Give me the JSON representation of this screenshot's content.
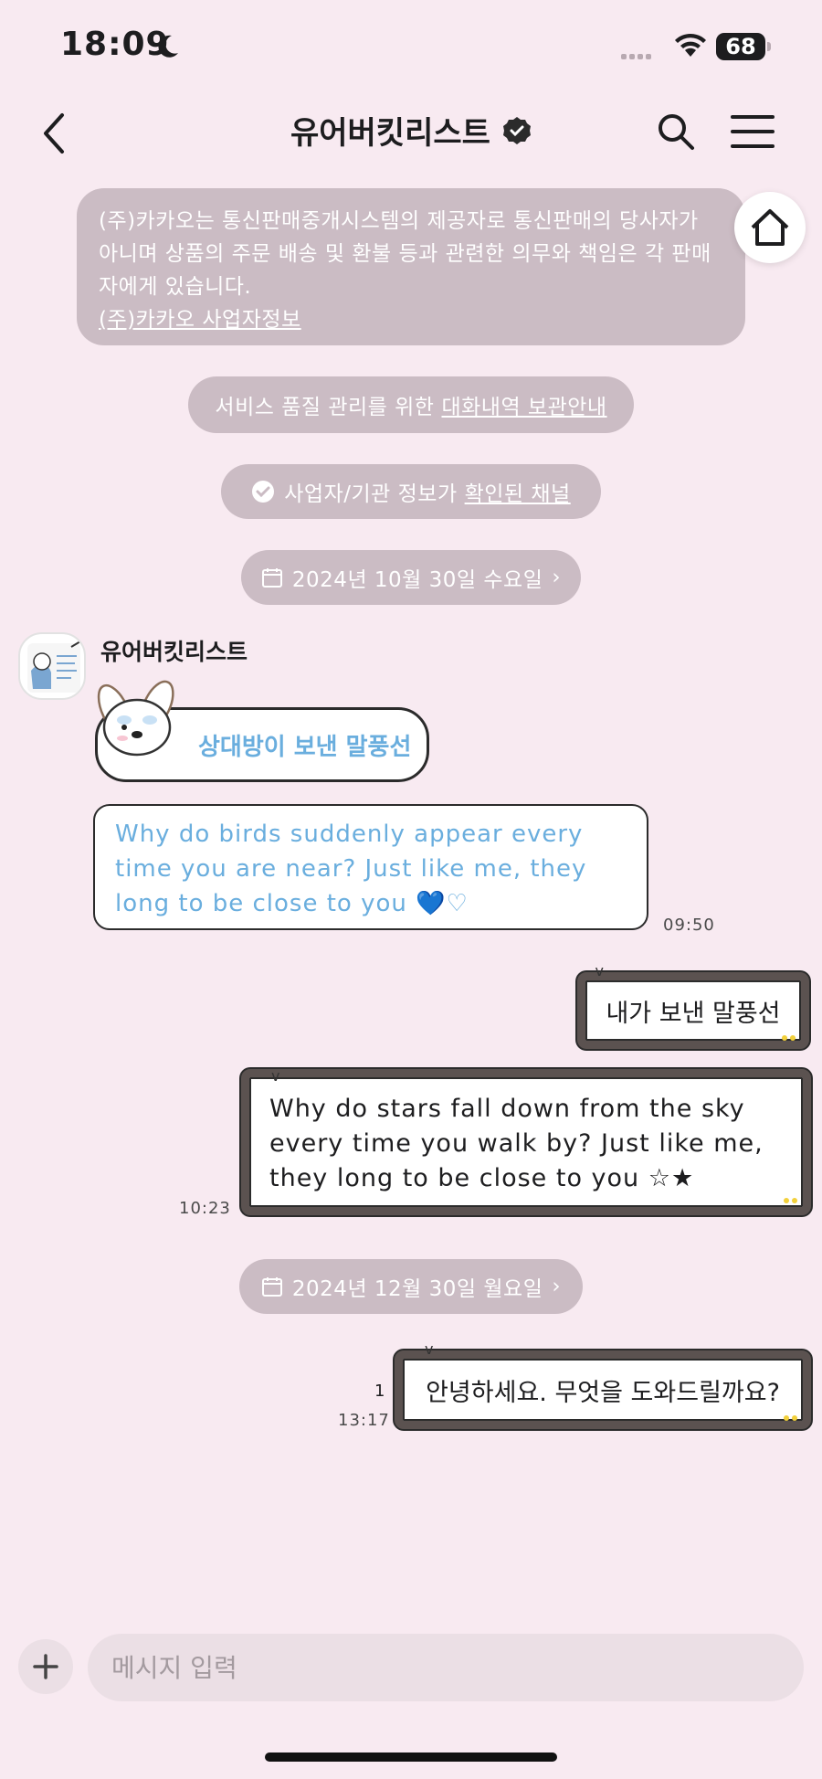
{
  "status_bar": {
    "time": "18:09",
    "battery": "68"
  },
  "header": {
    "title": "유어버킷리스트"
  },
  "notice": {
    "text": "(주)카카오는 통신판매중개시스템의 제공자로 통신판매의 당사자가 아니며 상품의 주문 배송 및 환불 등과 관련한 의무와 책임은 각 판매자에게 있습니다.",
    "link": "(주)카카오 사업자정보"
  },
  "service_notice": {
    "text": "서비스 품질 관리를 위한",
    "link": "대화내역 보관안내"
  },
  "verified_notice": {
    "text": "사업자/기관 정보가",
    "link": "확인된 채널"
  },
  "dates": {
    "first": "2024년 10월 30일 수요일",
    "second": "2024년 12월 30일 월요일"
  },
  "sender": {
    "name": "유어버킷리스트"
  },
  "messages": {
    "in_label": "상대방이 보낸 말풍선",
    "in_text": "Why do birds suddenly appear every time you are near? Just like me, they long to be close to you 💙♡",
    "in_time": "09:50",
    "out_label": "내가 보낸 말풍선",
    "out_text": "Why do stars fall down from the sky every time you walk by? Just like me, they long to be close to you ☆★",
    "out_time": "10:23",
    "out_greeting": "안녕하세요. 무엇을 도와드릴까요?",
    "greeting_unread": "1",
    "greeting_time": "13:17"
  },
  "input": {
    "placeholder": "메시지 입력"
  },
  "colors": {
    "background": "#f8eaf1",
    "pill": "#cbbcc4",
    "blue_text": "#6aaede",
    "chalk_frame": "#5b5250"
  },
  "icons": [
    "moon-icon",
    "wifi-icon",
    "back-icon",
    "verified-icon",
    "search-icon",
    "menu-icon",
    "home-icon",
    "check-circle-icon",
    "calendar-icon",
    "chevron-right-icon",
    "plus-icon"
  ]
}
